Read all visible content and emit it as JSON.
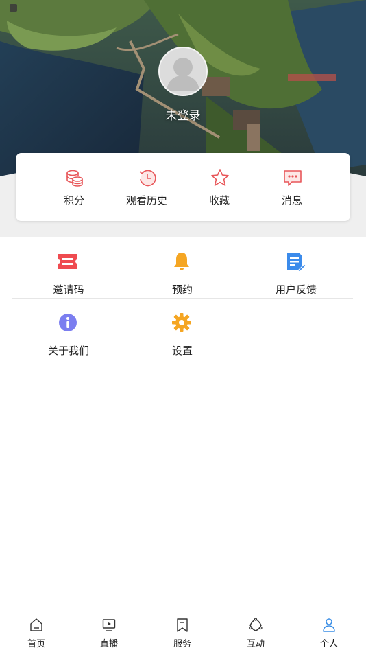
{
  "profile": {
    "login_status": "未登录"
  },
  "quick_actions": [
    {
      "label": "积分",
      "icon": "database-icon"
    },
    {
      "label": "观看历史",
      "icon": "history-icon"
    },
    {
      "label": "收藏",
      "icon": "star-icon"
    },
    {
      "label": "消息",
      "icon": "message-icon"
    }
  ],
  "menu": [
    {
      "label": "邀请码",
      "icon": "ticket-icon"
    },
    {
      "label": "预约",
      "icon": "bell-icon"
    },
    {
      "label": "用户反馈",
      "icon": "feedback-icon"
    },
    {
      "label": "关于我们",
      "icon": "info-icon"
    },
    {
      "label": "设置",
      "icon": "gear-icon"
    }
  ],
  "tabs": [
    {
      "label": "首页",
      "icon": "home-icon"
    },
    {
      "label": "直播",
      "icon": "tv-icon"
    },
    {
      "label": "服务",
      "icon": "bookmark-icon"
    },
    {
      "label": "互动",
      "icon": "interact-icon"
    },
    {
      "label": "个人",
      "icon": "person-icon",
      "active": true
    }
  ],
  "colors": {
    "accent_red": "#e8575a",
    "bell_orange": "#f5a623",
    "feedback_blue": "#3b8beb",
    "info_purple": "#7b7ef0",
    "active_tab": "#3a8ee6"
  }
}
